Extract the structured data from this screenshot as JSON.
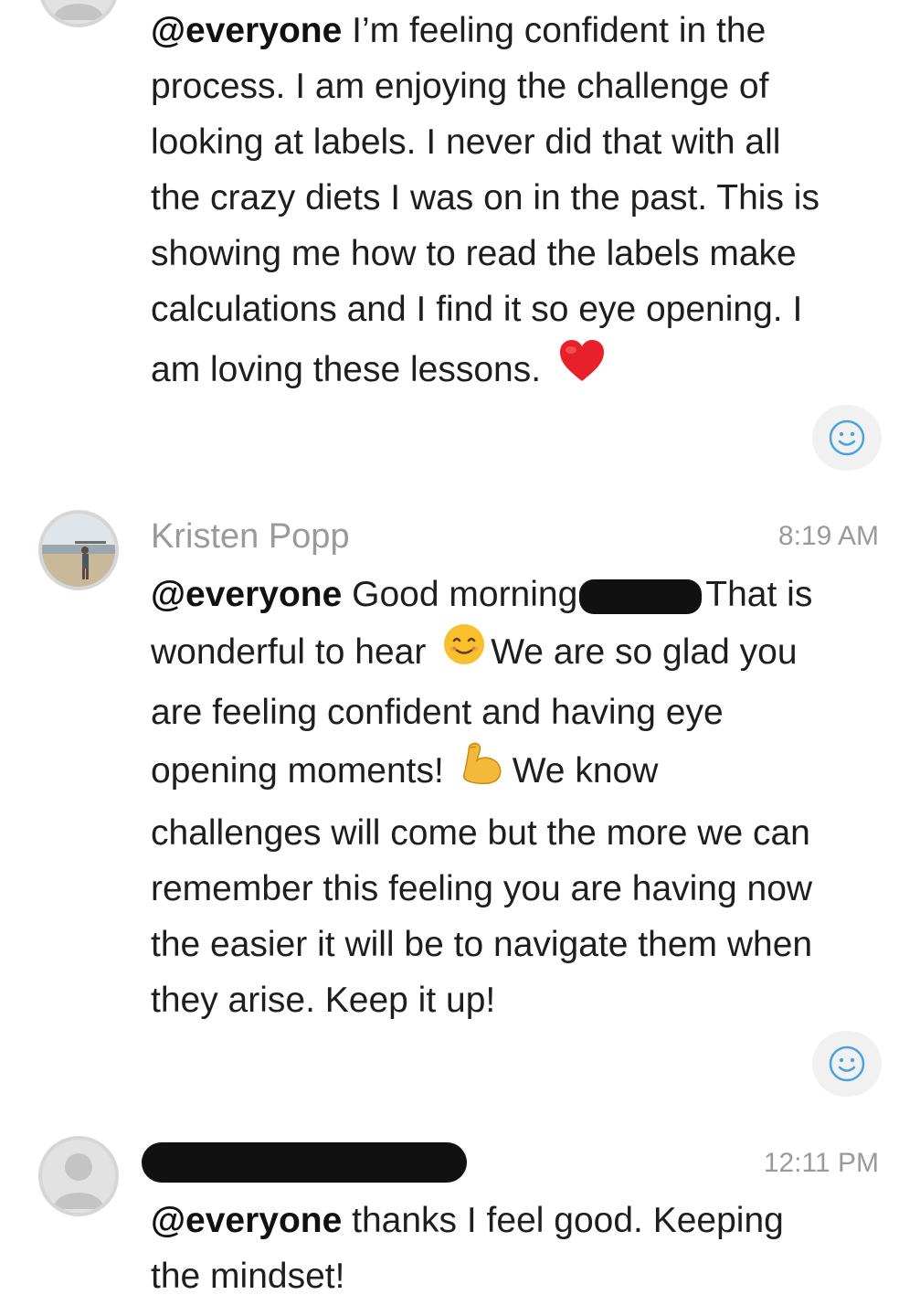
{
  "messages": [
    {
      "mention": "@everyone",
      "lines": [
        " I’m feeling confident in the",
        "process. I am enjoying the challenge of",
        "looking at labels. I never did that with all",
        "the crazy diets I was on in the past. This is",
        "showing me how to read the labels make",
        "calculations and I find it so eye opening. I",
        "am loving these lessons."
      ],
      "emoji": "heart-icon"
    },
    {
      "author": "Kristen Popp",
      "time": "8:19 AM",
      "mention": "@everyone",
      "seg1": " Good morning",
      "seg2": "That is",
      "seg3": "wonderful to hear",
      "seg4": "We are so glad you",
      "line3": "are feeling confident and having eye",
      "seg5": "opening moments!",
      "seg6": "We know",
      "lines_rest": [
        "challenges will come but the more we can",
        "remember this feeling you are having now",
        "the easier it will be to navigate them when",
        "they arise. Keep it up!"
      ]
    },
    {
      "time": "12:11 PM",
      "mention": "@everyone",
      "line1": " thanks I feel good. Keeping",
      "line2": "the mindset!"
    }
  ],
  "colors": {
    "reaction_icon": "#4aa3df",
    "meta_text": "#9a9a9a",
    "body_text": "#1e1e1e"
  }
}
